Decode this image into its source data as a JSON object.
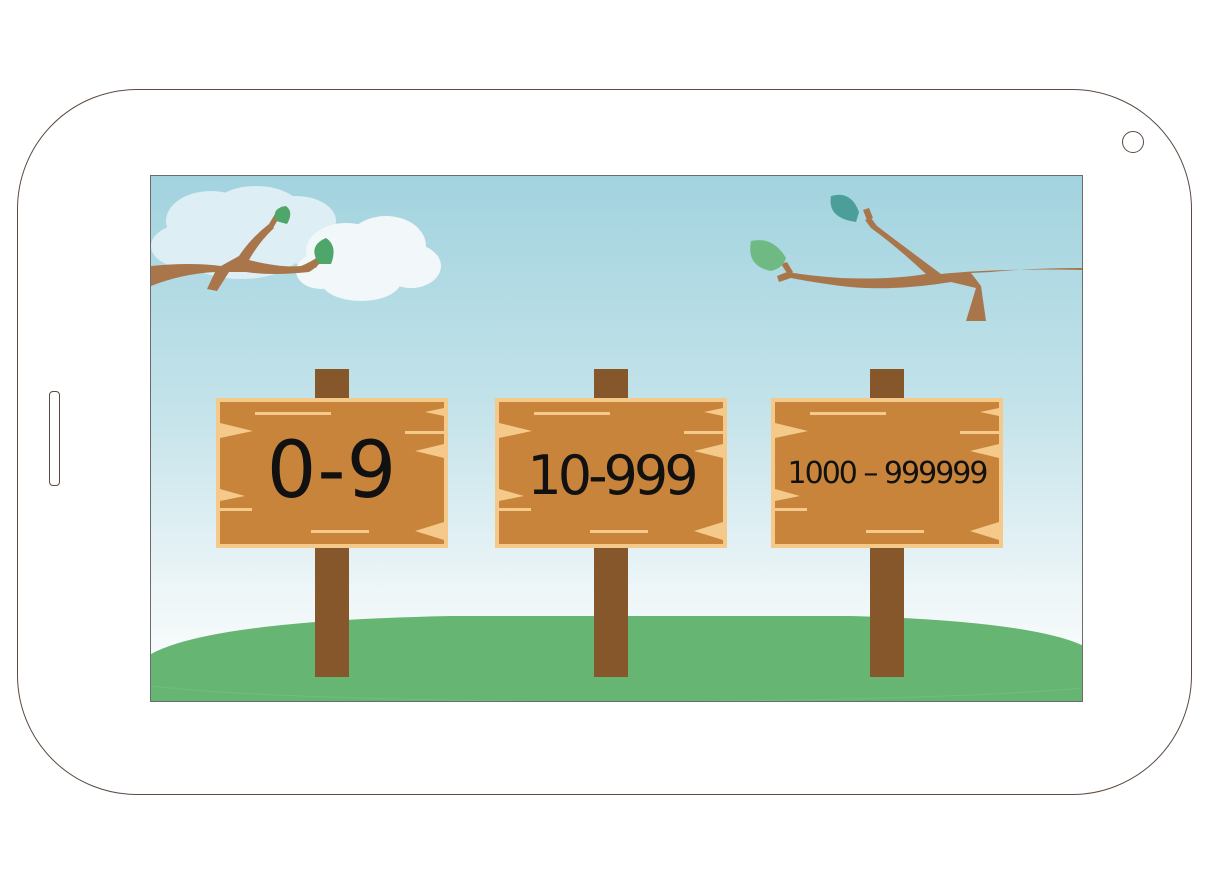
{
  "screen": {
    "colors": {
      "sky_top": "#a2d3df",
      "sky_bottom": "#ffffff",
      "grass": "#66b573",
      "wood": "#c8843b",
      "wood_edge": "#f4c98a",
      "post": "#87572c",
      "branch": "#a8764a",
      "leaf_green": "#4fa66a",
      "leaf_light": "#6fba82",
      "leaf_teal": "#4b9e9a"
    },
    "signs": [
      {
        "label": "0-9"
      },
      {
        "label": "10-999"
      },
      {
        "label": "1000 – 999999"
      }
    ]
  }
}
